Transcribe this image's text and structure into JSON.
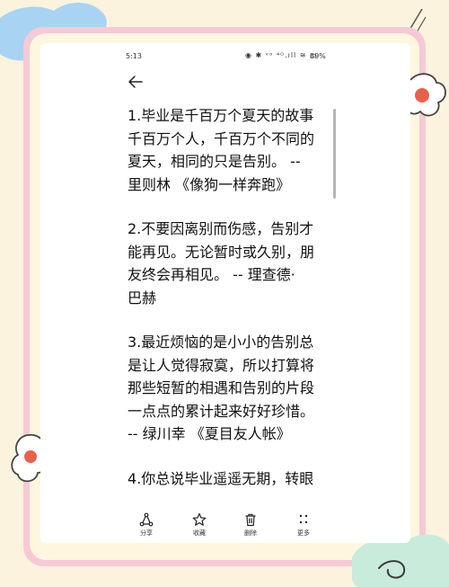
{
  "status_bar": {
    "time": "5:13",
    "icons": "◉ ✱ ᵛᵒ ⁴ᴳ.ıll ≋ ▭",
    "battery": "89%"
  },
  "nav": {
    "back_icon": "arrow-left-icon"
  },
  "article": {
    "paragraphs": [
      {
        "lines": [
          "1.毕业是千百万个夏天的故事",
          "千百万个人，千百万个不同的",
          "夏天，相同的只是告别。 --",
          "里则林 《像狗一样奔跑》"
        ]
      },
      {
        "lines": [
          "2.不要因离别而伤感，告别才",
          "能再见。无论暂时或久别，朋",
          "友终会再相见。 -- 理查德·",
          "巴赫"
        ]
      },
      {
        "lines": [
          "3.最近烦恼的是小小的告别总",
          "是让人觉得寂寞，所以打算将",
          "那些短暂的相遇和告别的片段",
          "一点点的累计起来好好珍惜。",
          "-- 绿川幸 《夏目友人帐》"
        ]
      },
      {
        "lines": [
          "4.你总说毕业遥遥无期，转眼"
        ]
      }
    ]
  },
  "toolbar": {
    "share": {
      "label": "分享",
      "icon": "share-icon"
    },
    "favorite": {
      "label": "收藏",
      "icon": "star-icon"
    },
    "delete": {
      "label": "删除",
      "icon": "trash-icon"
    },
    "more": {
      "label": "更多",
      "icon": "more-dots-icon"
    }
  },
  "colors": {
    "background": "#fbf3dd",
    "frame_pink": "#f7c9d6",
    "decor_blue": "#a9d3f2",
    "decor_green": "#c9ebdc",
    "flower_red": "#e8604c"
  }
}
